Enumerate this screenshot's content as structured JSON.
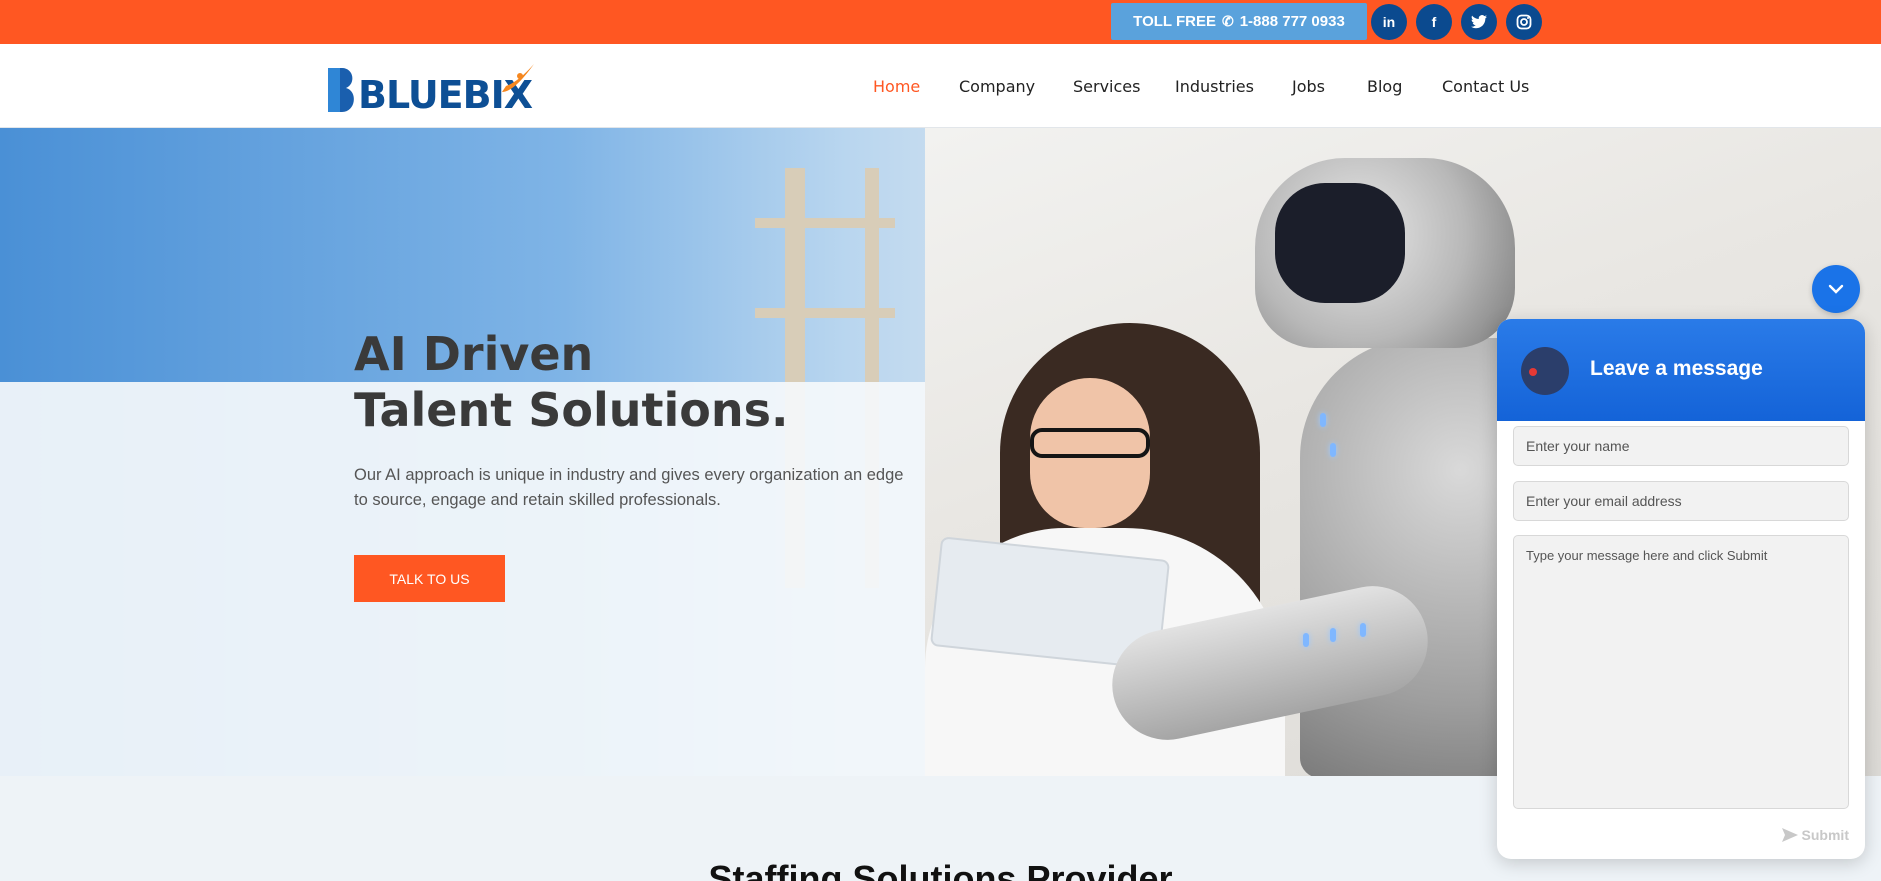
{
  "topbar": {
    "tollfree_label": "TOLL FREE",
    "phone": "1-888 777 0933",
    "social": [
      {
        "icon": "linkedin-icon",
        "glyph": "in"
      },
      {
        "icon": "facebook-icon",
        "glyph": "f"
      },
      {
        "icon": "twitter-icon",
        "glyph": "t"
      },
      {
        "icon": "instagram-icon",
        "glyph": "◎"
      }
    ]
  },
  "header": {
    "logo_text_main": "BLUEBI",
    "logo_text_x": "X",
    "nav": [
      "Home",
      "Company",
      "Services",
      "Industries",
      "Jobs",
      "Blog",
      "Contact Us"
    ],
    "active_nav": "Home"
  },
  "hero": {
    "title_line1": "AI Driven",
    "title_line2": "Talent Solutions.",
    "description": "Our AI approach is unique in industry and gives every organization an edge to source, engage and retain skilled professionals.",
    "cta": "TALK TO US"
  },
  "section": {
    "title": "Staffing Solutions Provider"
  },
  "chat": {
    "title": "Leave a message",
    "name_placeholder": "Enter your name",
    "email_placeholder": "Enter your email address",
    "message_placeholder": "Type your message here and click Submit",
    "submit_label": "Submit"
  },
  "colors": {
    "accent": "#ff5722",
    "brand": "#0d4f95",
    "chat_blue": "#1463d8",
    "tollfree_bg": "#5aa2dc"
  }
}
